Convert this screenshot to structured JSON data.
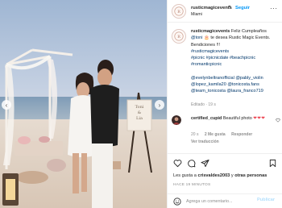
{
  "header": {
    "username": "rusticmagicevents",
    "dot": "•",
    "follow_label": "Seguir",
    "location": "Miami",
    "more_label": "···"
  },
  "photo": {
    "prev_label": "‹",
    "next_label": "›",
    "sign_lines": [
      "Toni",
      "&",
      "Lia"
    ]
  },
  "caption": {
    "username": "rusticmagicevents",
    "text_1": " Feliz Cumpleaños ",
    "mention_1": "@toni",
    "text_2": " 🎂 te desea Rustic Magic Events.",
    "text_3": "Bendiciones !!!",
    "hashtags": [
      "#rusticmagicevents",
      "#picnic",
      "#picnicdate",
      "#beachpicnic",
      "#romanticpicnic"
    ],
    "mentions": [
      "@evelynbeltranofficial",
      "@pably_violin",
      "@lopez_kamila20",
      "@tonicosta.fans",
      "@team_tonicosta",
      "@laura_franco719"
    ],
    "time": "Editado · 19 s"
  },
  "comment": {
    "username": "certified_cupid",
    "text": " Beautiful photo ",
    "hearts": "❤❤❤",
    "time": "20 s",
    "likes": "2 Me gusta",
    "reply": "Responder",
    "more": "···",
    "view_replies": "Ver traducción"
  },
  "actions": {
    "likes_prefix": "Les gusta a ",
    "likes_user": "crisvaldes2003",
    "likes_mid": " y ",
    "likes_others": "otras personas",
    "date": "HACE 19 MINUTOS"
  },
  "add_comment": {
    "placeholder": "Agrega un comentario...",
    "publish_label": "Publicar"
  },
  "colors": {
    "accent": "#0095f6",
    "like_red": "#ed4956",
    "muted": "#8e8e8e"
  }
}
